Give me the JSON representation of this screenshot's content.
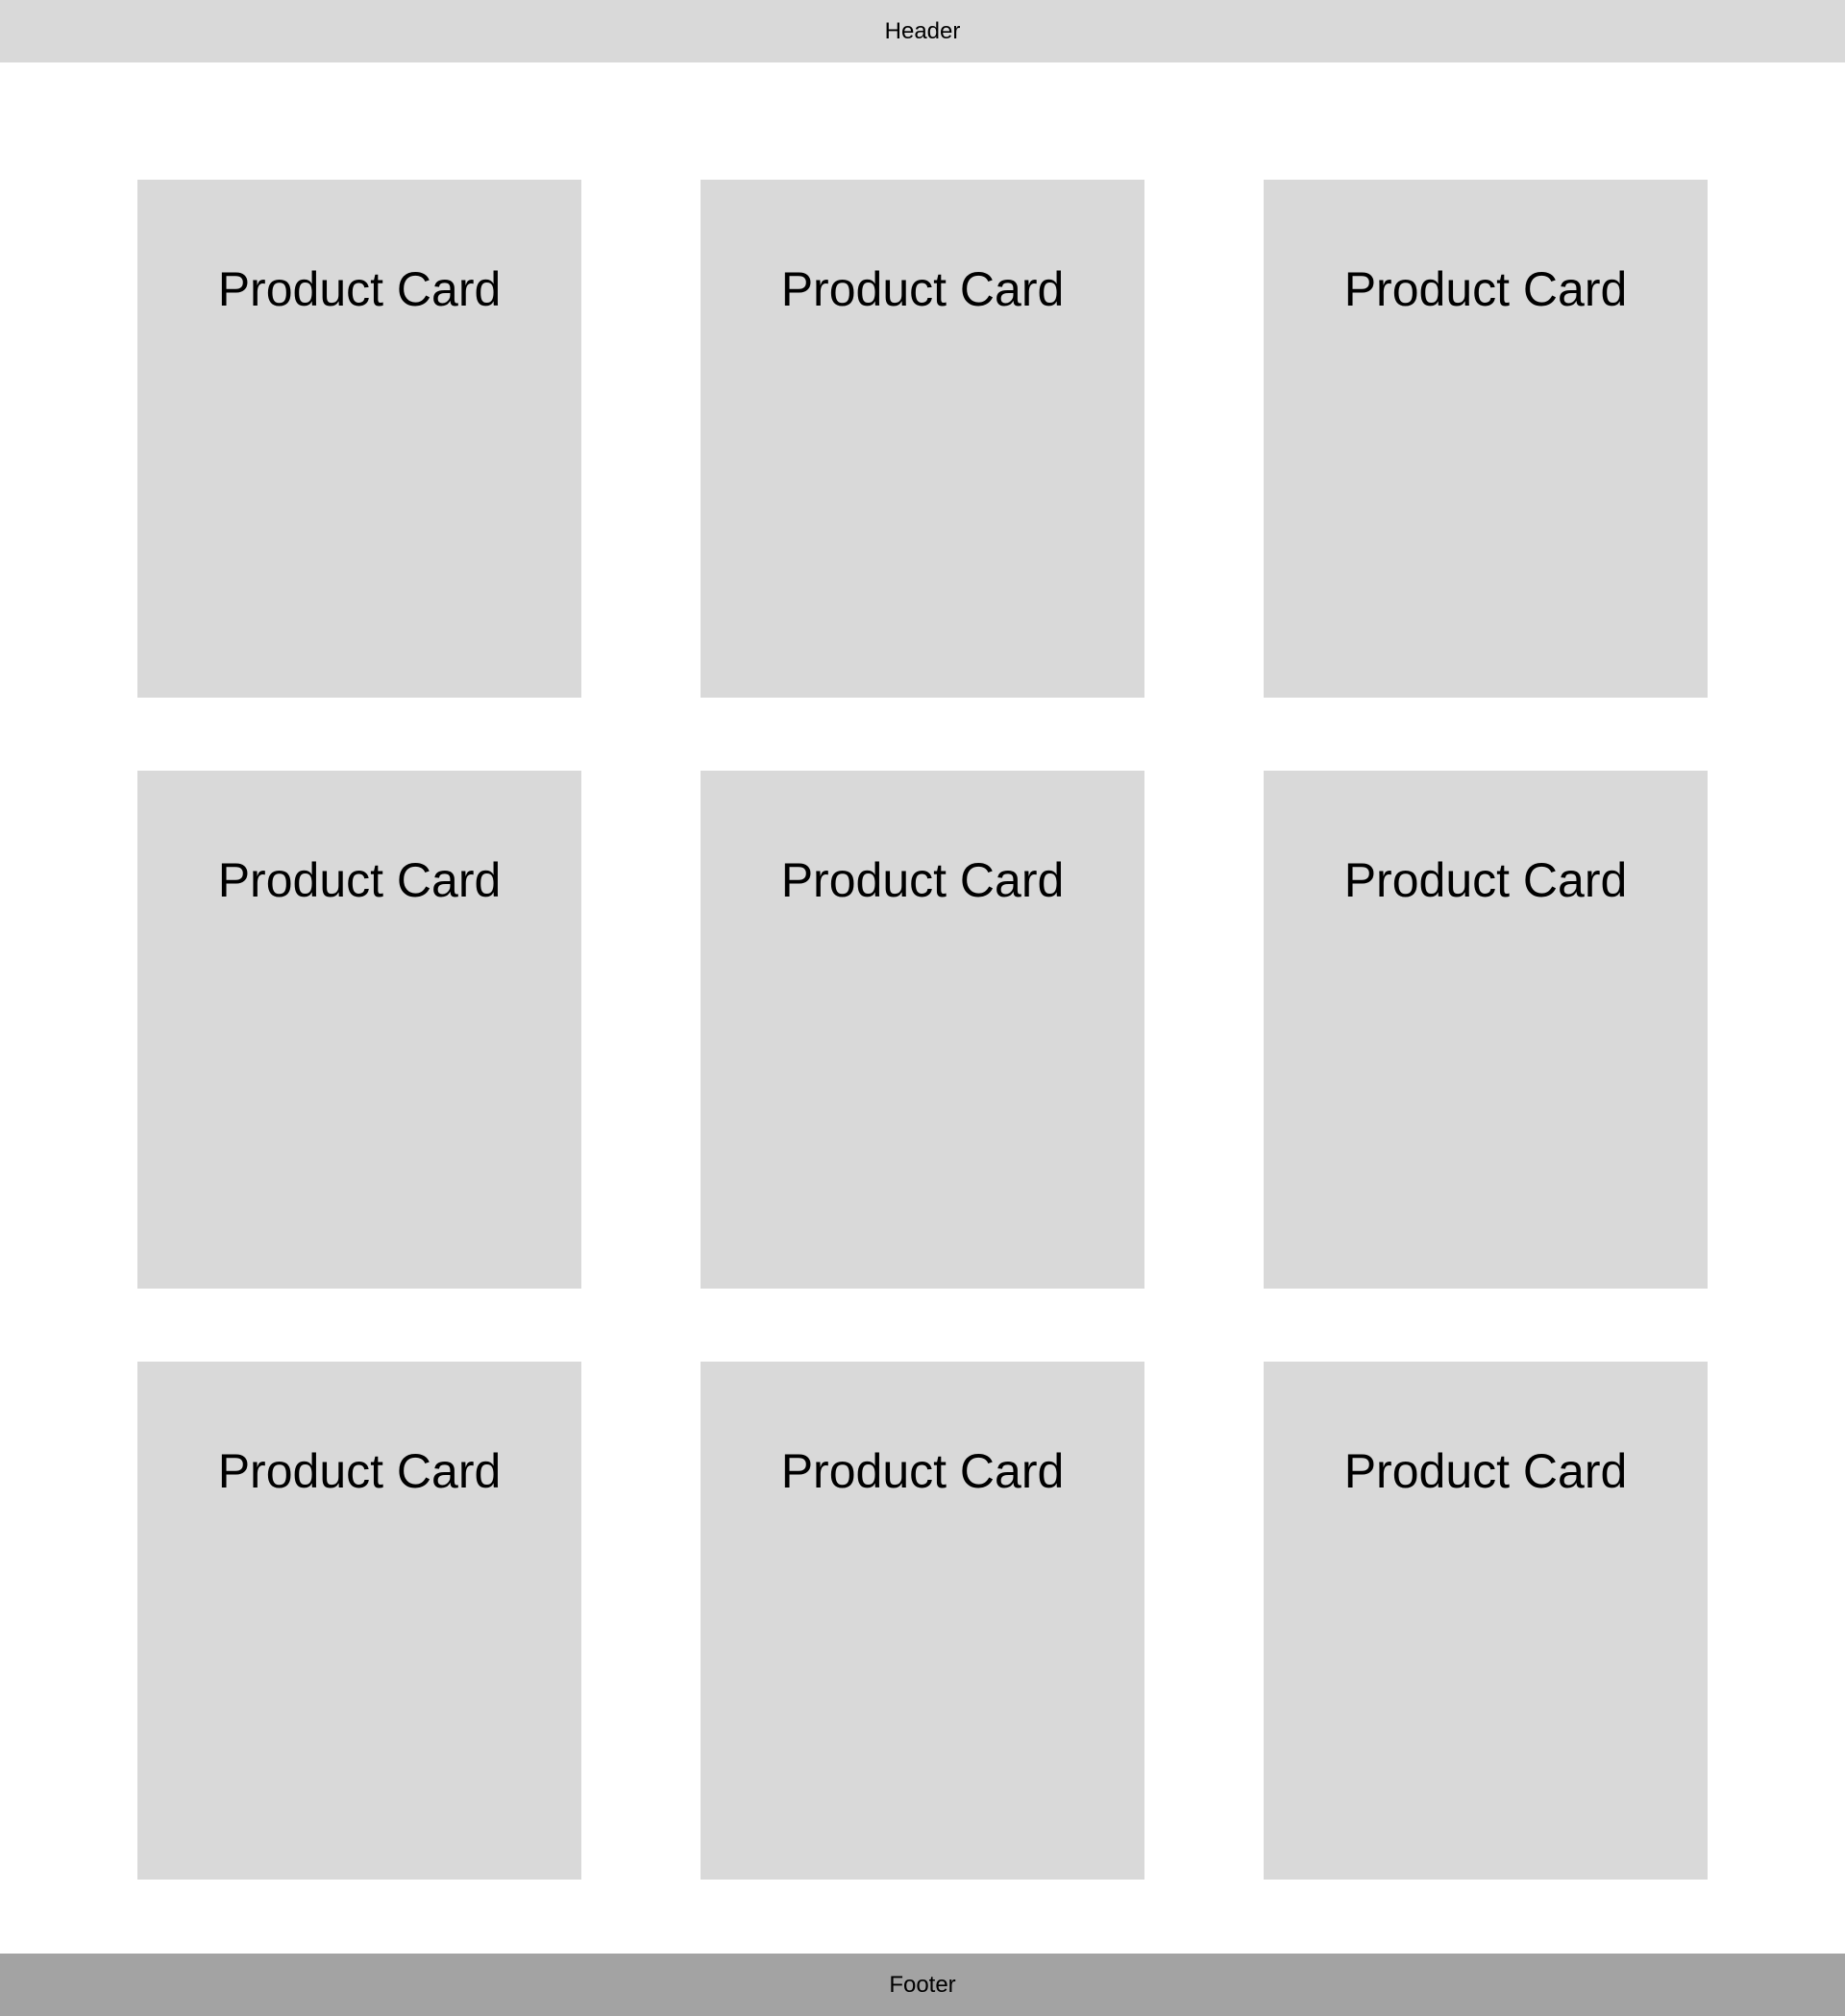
{
  "header": {
    "label": "Header",
    "background": "#d9d9d9"
  },
  "products": {
    "card_background": "#d9d9d9",
    "items": [
      {
        "label": "Product Card"
      },
      {
        "label": "Product Card"
      },
      {
        "label": "Product Card"
      },
      {
        "label": "Product Card"
      },
      {
        "label": "Product Card"
      },
      {
        "label": "Product Card"
      },
      {
        "label": "Product Card"
      },
      {
        "label": "Product Card"
      },
      {
        "label": "Product Card"
      }
    ]
  },
  "footer": {
    "label": "Footer",
    "background": "#a3a3a3"
  }
}
